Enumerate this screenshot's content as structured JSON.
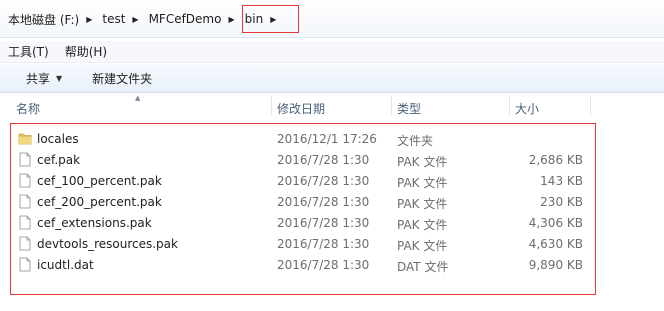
{
  "breadcrumb": {
    "items": [
      "本地磁盘 (F:)",
      "test",
      "MFCefDemo",
      "bin"
    ]
  },
  "menu": {
    "items": [
      "工具(T)",
      "帮助(H)"
    ]
  },
  "toolbar": {
    "share_label": "共享",
    "new_folder_label": "新建文件夹"
  },
  "columns": {
    "name": "名称",
    "date": "修改日期",
    "type": "类型",
    "size": "大小"
  },
  "files": [
    {
      "name": "locales",
      "date": "2016/12/1 17:26",
      "type": "文件夹",
      "size": "",
      "icon": "folder-icon"
    },
    {
      "name": "cef.pak",
      "date": "2016/7/28 1:30",
      "type": "PAK 文件",
      "size": "2,686 KB",
      "icon": "file-icon"
    },
    {
      "name": "cef_100_percent.pak",
      "date": "2016/7/28 1:30",
      "type": "PAK 文件",
      "size": "143 KB",
      "icon": "file-icon"
    },
    {
      "name": "cef_200_percent.pak",
      "date": "2016/7/28 1:30",
      "type": "PAK 文件",
      "size": "230 KB",
      "icon": "file-icon"
    },
    {
      "name": "cef_extensions.pak",
      "date": "2016/7/28 1:30",
      "type": "PAK 文件",
      "size": "4,306 KB",
      "icon": "file-icon"
    },
    {
      "name": "devtools_resources.pak",
      "date": "2016/7/28 1:30",
      "type": "PAK 文件",
      "size": "4,630 KB",
      "icon": "file-icon"
    },
    {
      "name": "icudtl.dat",
      "date": "2016/7/28 1:30",
      "type": "DAT 文件",
      "size": "9,890 KB",
      "icon": "file-icon"
    }
  ],
  "colors": {
    "annotation": "#e63838",
    "folder": "#e8c25a"
  }
}
